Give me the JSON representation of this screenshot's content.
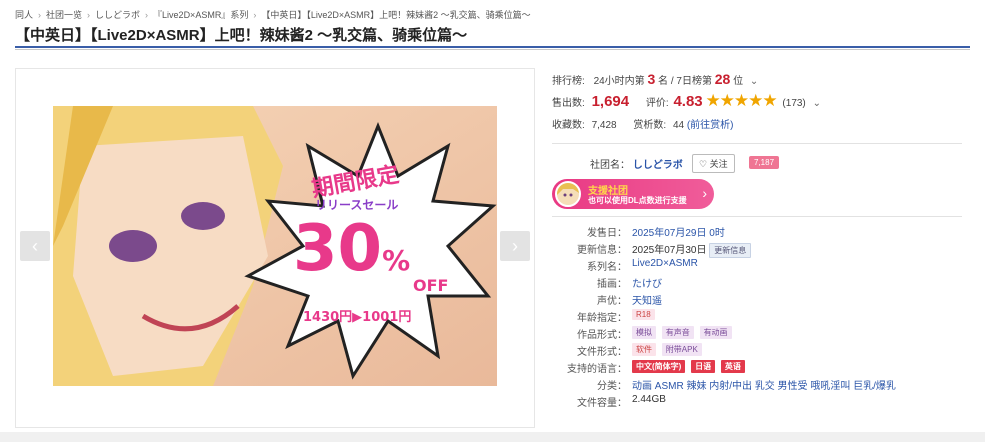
{
  "breadcrumb": [
    "同人",
    "社团一览",
    "ししどラボ",
    "『Live2D×ASMR』系列",
    "【中英日】【Live2D×ASMR】上吧！辣妹酱2 ～乳交篇、骑乘位篇～"
  ],
  "title": "【中英日】【Live2D×ASMR】上吧！辣妹酱2 ～乳交篇、骑乘位篇～",
  "ranking": {
    "label": "排行榜:",
    "d24": "24小时内第",
    "d24_rank": "3",
    "unit": "名",
    "sep": "/",
    "d7": "7日榜第",
    "d7_rank": "28",
    "unit2": "位"
  },
  "sales": {
    "label": "售出数:",
    "value": "1,694",
    "rating_label": "评价:",
    "rating": "4.83",
    "stars": "★★★★★",
    "count": "(173)"
  },
  "favorites": {
    "label": "收藏数:",
    "value": "7,428",
    "reviews_label": "赏析数:",
    "reviews": "44",
    "reviews_link": "(前往赏析)"
  },
  "circle": {
    "label": "社团名：",
    "name": "ししどラボ",
    "follow": "♡ 关注",
    "followers": "7,187"
  },
  "support": {
    "title": "支援社团",
    "subtitle": "也可以使用DL点数进行支援"
  },
  "details": [
    {
      "label": "发售日：",
      "value": "2025年07月29日 0时"
    },
    {
      "label": "更新信息：",
      "value": "2025年07月30日",
      "tag": "更新信息"
    },
    {
      "label": "系列名：",
      "value": "Live2D×ASMR"
    },
    {
      "label": "插画：",
      "value": "たけび"
    },
    {
      "label": "声优：",
      "value": "天知遥"
    },
    {
      "label": "年龄指定：",
      "tags": [
        "R18"
      ]
    },
    {
      "label": "作品形式：",
      "tags": [
        "模拟",
        "有声音",
        "有动画"
      ]
    },
    {
      "label": "文件形式：",
      "tags": [
        "软件",
        "附带APK"
      ]
    },
    {
      "label": "支持的语言：",
      "tags": [
        "中文(简体字)",
        "日语",
        "英语"
      ]
    },
    {
      "label": "分类：",
      "value": "动画  ASMR  辣妹  内射/中出  乳交  男性受  哦吼淫叫  巨乳/爆乳"
    },
    {
      "label": "文件容量：",
      "value": "2.44GB"
    }
  ],
  "banner": {
    "top": "期間限定",
    "sub": "リリースセール",
    "big": "30",
    "pct": "%",
    "off": "OFF",
    "price": "1430円▶1001円"
  },
  "colors": {
    "accent": "#3a5ea8",
    "red": "#c8202f",
    "pink": "#e93983"
  }
}
